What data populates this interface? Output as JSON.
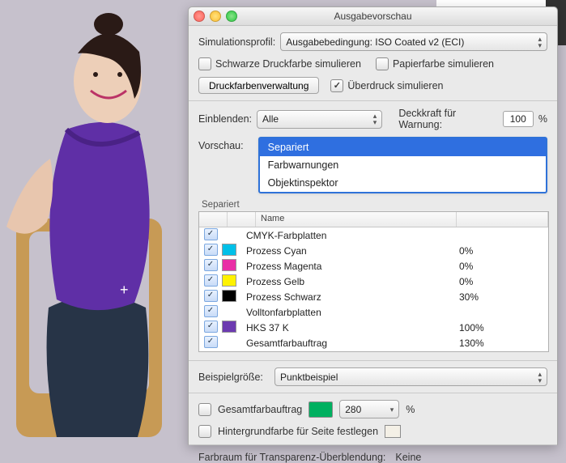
{
  "dialog": {
    "title": "Ausgabevorschau",
    "sim_profile_label": "Simulationsprofil:",
    "sim_profile_value": "Ausgabebedingung: ISO Coated v2 (ECI)",
    "cb_black_ink": "Schwarze Druckfarbe simulieren",
    "cb_paper": "Papierfarbe simulieren",
    "btn_ink_mgmt": "Druckfarbenverwaltung",
    "cb_overprint": "Überdruck simulieren",
    "einblenden_label": "Einblenden:",
    "einblenden_value": "Alle",
    "opacity_label": "Deckkraft für Warnung:",
    "opacity_value": "100",
    "percent": "%",
    "vorschau_label": "Vorschau:",
    "vorschau_options": [
      "Separiert",
      "Farbwarnungen",
      "Objektinspektor"
    ],
    "vorschau_selected": 0,
    "separations_label": "Separiert",
    "table": {
      "col_name": "Name",
      "rows": [
        {
          "swatch": "",
          "name": "CMYK-Farbplatten",
          "value": ""
        },
        {
          "swatch": "#00C0E8",
          "name": "Prozess Cyan",
          "value": "0%"
        },
        {
          "swatch": "#E92EA6",
          "name": "Prozess Magenta",
          "value": "0%"
        },
        {
          "swatch": "#FFF200",
          "name": "Prozess Gelb",
          "value": "0%"
        },
        {
          "swatch": "#000000",
          "name": "Prozess Schwarz",
          "value": "30%"
        },
        {
          "swatch": "",
          "name": "Volltonfarbplatten",
          "value": ""
        },
        {
          "swatch": "#6C3AB0",
          "name": "HKS 37 K",
          "value": "100%"
        },
        {
          "swatch": "",
          "name": "Gesamtfarbauftrag",
          "value": "130%"
        }
      ]
    },
    "sample_size_label": "Beispielgröße:",
    "sample_size_value": "Punktbeispiel",
    "total_ink_label": "Gesamtfarbauftrag",
    "total_ink_swatch": "#00B060",
    "total_ink_value": "280",
    "bg_color_label": "Hintergrundfarbe für Seite festlegen",
    "bg_color_swatch": "#F4F0E6",
    "transparency_label": "Farbraum für Transparenz-Überblendung:",
    "transparency_value": "Keine"
  }
}
